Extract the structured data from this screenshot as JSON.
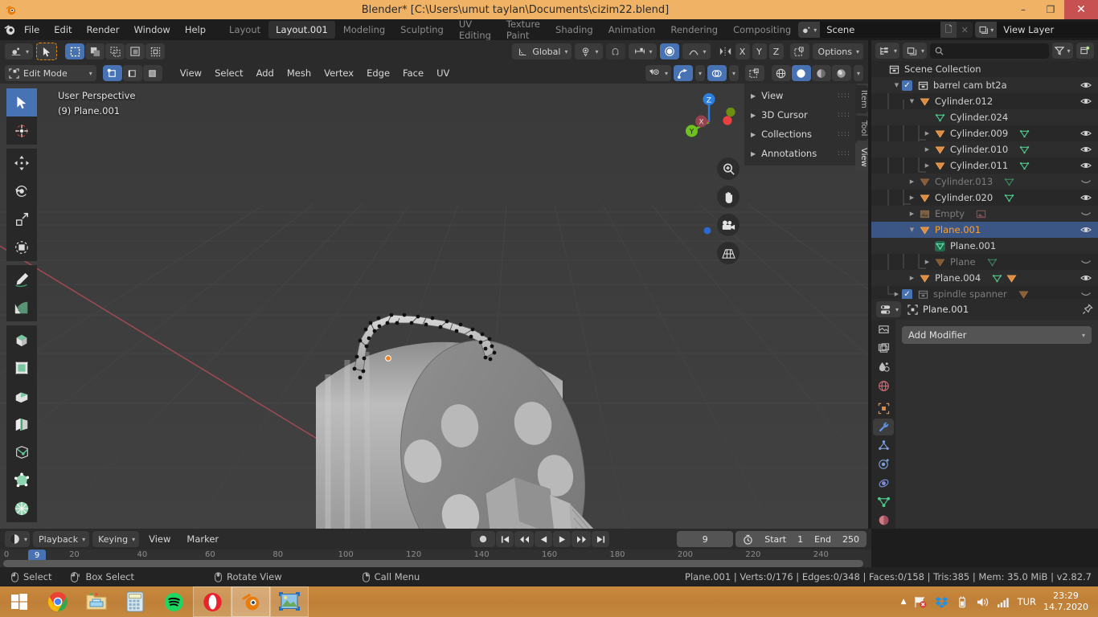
{
  "window": {
    "title": "Blender* [C:\\Users\\umut taylan\\Documents\\cizim22.blend]",
    "minimize": "–",
    "maximize": "❐",
    "close": "✕"
  },
  "topbar": {
    "menus": [
      "File",
      "Edit",
      "Render",
      "Window",
      "Help"
    ],
    "workspaces": [
      {
        "label": "Layout",
        "active": false
      },
      {
        "label": "Layout.001",
        "active": true
      },
      {
        "label": "Modeling",
        "active": false
      },
      {
        "label": "Sculpting",
        "active": false
      },
      {
        "label": "UV Editing",
        "active": false
      },
      {
        "label": "Texture Paint",
        "active": false
      },
      {
        "label": "Shading",
        "active": false
      },
      {
        "label": "Animation",
        "active": false
      },
      {
        "label": "Rendering",
        "active": false
      },
      {
        "label": "Compositing",
        "active": false
      }
    ],
    "scene_name": "Scene",
    "view_layer_name": "View Layer"
  },
  "viewport_header": {
    "transform_orientation": "Global",
    "options_label": "Options",
    "axis_x": "X",
    "axis_y": "Y",
    "axis_z": "Z",
    "mode": "Edit Mode",
    "menus": [
      "View",
      "Select",
      "Add",
      "Mesh",
      "Vertex",
      "Edge",
      "Face",
      "UV"
    ]
  },
  "viewport": {
    "perspective_label": "User Perspective",
    "object_label": "(9) Plane.001",
    "gizmo_axes": {
      "x": "X",
      "y": "Y",
      "z": "Z"
    },
    "npanel": {
      "sections": [
        "View",
        "3D Cursor",
        "Collections",
        "Annotations"
      ],
      "tabs": [
        {
          "label": "Item",
          "active": false
        },
        {
          "label": "Tool",
          "active": false
        },
        {
          "label": "View",
          "active": true
        }
      ]
    },
    "tools": [
      "tweak-tool",
      "cursor-tool",
      "move-tool",
      "rotate-tool",
      "scale-tool",
      "transform-tool",
      "annotate-tool",
      "measure-tool",
      "extrude-region-tool",
      "inset-faces-tool",
      "bevel-tool",
      "loop-cut-tool",
      "knife-tool",
      "poly-build-tool",
      "spin-tool"
    ]
  },
  "outliner": {
    "search_placeholder": "",
    "rows": [
      {
        "indent": 0,
        "name": "Scene Collection",
        "icon": "collection-icon",
        "state": "normal",
        "eye": false,
        "checkbox": false,
        "disclosure": "",
        "datas": []
      },
      {
        "indent": 1,
        "name": "barrel cam bt2a",
        "icon": "collection-icon",
        "state": "normal",
        "eye": true,
        "checkbox": true,
        "disclosure": "down",
        "datas": []
      },
      {
        "indent": 2,
        "name": "Cylinder.012",
        "icon": "mesh-object-icon",
        "state": "normal",
        "eye": true,
        "checkbox": false,
        "disclosure": "down",
        "datas": []
      },
      {
        "indent": 3,
        "name": "Cylinder.024",
        "icon": "mesh-data-icon",
        "state": "normal",
        "eye": false,
        "checkbox": false,
        "disclosure": "",
        "datas": []
      },
      {
        "indent": 3,
        "name": "Cylinder.009",
        "icon": "mesh-object-icon",
        "state": "normal",
        "eye": true,
        "checkbox": false,
        "disclosure": "right",
        "datas": [
          "mesh-data-icon"
        ]
      },
      {
        "indent": 3,
        "name": "Cylinder.010",
        "icon": "mesh-object-icon",
        "state": "normal",
        "eye": true,
        "checkbox": false,
        "disclosure": "right",
        "datas": [
          "mesh-data-icon"
        ]
      },
      {
        "indent": 3,
        "name": "Cylinder.011",
        "icon": "mesh-object-icon",
        "state": "normal",
        "eye": true,
        "checkbox": false,
        "disclosure": "right",
        "datas": [
          "mesh-data-icon"
        ]
      },
      {
        "indent": 2,
        "name": "Cylinder.013",
        "icon": "mesh-object-icon",
        "state": "hidden",
        "eye": "closed",
        "checkbox": false,
        "disclosure": "right",
        "datas": [
          "mesh-data-icon"
        ]
      },
      {
        "indent": 2,
        "name": "Cylinder.020",
        "icon": "mesh-object-icon",
        "state": "normal",
        "eye": true,
        "checkbox": false,
        "disclosure": "right",
        "datas": [
          "mesh-data-icon"
        ]
      },
      {
        "indent": 2,
        "name": "Empty",
        "icon": "empty-image-icon",
        "state": "hidden",
        "eye": "closed",
        "checkbox": false,
        "disclosure": "right",
        "datas": [
          "image-icon"
        ]
      },
      {
        "indent": 2,
        "name": "Plane.001",
        "icon": "mesh-object-icon",
        "state": "selected",
        "eye": true,
        "checkbox": false,
        "disclosure": "down",
        "datas": []
      },
      {
        "indent": 3,
        "name": "Plane.001",
        "icon": "mesh-data-icon-active",
        "state": "normal",
        "eye": false,
        "checkbox": false,
        "disclosure": "",
        "datas": []
      },
      {
        "indent": 3,
        "name": "Plane",
        "icon": "mesh-object-icon",
        "state": "hidden",
        "eye": "closed",
        "checkbox": false,
        "disclosure": "right",
        "datas": [
          "mesh-data-icon"
        ]
      },
      {
        "indent": 2,
        "name": "Plane.004",
        "icon": "mesh-object-icon",
        "state": "normal",
        "eye": true,
        "checkbox": false,
        "disclosure": "right",
        "datas": [
          "mesh-data-icon",
          "modifier-icon"
        ]
      },
      {
        "indent": 1,
        "name": "spindle spanner",
        "icon": "collection-icon",
        "state": "hidden",
        "eye": "closed",
        "checkbox": true,
        "disclosure": "right",
        "datas": [
          "mesh-object-icon"
        ]
      }
    ]
  },
  "properties": {
    "breadcrumb_object": "Plane.001",
    "add_modifier_label": "Add Modifier",
    "tabs": [
      {
        "name": "tool-tab",
        "active": false
      },
      {
        "name": "render-tab",
        "active": false
      },
      {
        "name": "output-tab",
        "active": false
      },
      {
        "name": "view-layer-tab",
        "active": false
      },
      {
        "name": "scene-tab",
        "active": false
      },
      {
        "name": "world-tab",
        "active": false
      },
      {
        "name": "object-tab",
        "active": false
      },
      {
        "name": "modifier-tab",
        "active": true
      },
      {
        "name": "particles-tab",
        "active": false
      },
      {
        "name": "physics-tab",
        "active": false
      },
      {
        "name": "constraints-tab",
        "active": false
      },
      {
        "name": "data-tab",
        "active": false
      },
      {
        "name": "material-tab",
        "active": false
      }
    ]
  },
  "timeline": {
    "menus": [
      "Playback",
      "Keying",
      "View",
      "Marker"
    ],
    "current_frame": "9",
    "start_label": "Start",
    "start_value": "1",
    "end_label": "End",
    "end_value": "250",
    "ticks": [
      "0",
      "20",
      "40",
      "60",
      "80",
      "100",
      "120",
      "140",
      "160",
      "180",
      "200",
      "220",
      "240"
    ],
    "tick_values": [
      0,
      20,
      40,
      60,
      80,
      100,
      120,
      140,
      160,
      180,
      200,
      220,
      240
    ]
  },
  "statusbar": {
    "mouse_hints": [
      {
        "icon": "mouse-left-icon",
        "label": "Select"
      },
      {
        "icon": "mouse-drag-icon",
        "label": "Box Select"
      },
      {
        "icon": "mouse-middle-icon",
        "label": "Rotate View"
      },
      {
        "icon": "mouse-right-icon",
        "label": "Call Menu"
      }
    ],
    "stats": "Plane.001 | Verts:0/176 | Edges:0/348 | Faces:0/158 | Tris:385 | Mem: 35.0 MiB | v2.82.7"
  },
  "taskbar": {
    "apps": [
      {
        "name": "start-button",
        "state": "normal"
      },
      {
        "name": "chrome-icon",
        "state": "normal"
      },
      {
        "name": "file-explorer-icon",
        "state": "normal"
      },
      {
        "name": "calculator-icon",
        "state": "normal"
      },
      {
        "name": "spotify-icon",
        "state": "normal"
      },
      {
        "name": "opera-icon",
        "state": "open"
      },
      {
        "name": "blender-icon",
        "state": "active"
      },
      {
        "name": "photos-icon",
        "state": "open"
      }
    ],
    "language": "TUR",
    "time": "23:29",
    "date": "14.7.2020"
  },
  "colors": {
    "accent_blue": "#4772b3",
    "blender_orange": "#e87d0d",
    "title_bar": "#f0b265",
    "selection_orange": "#ffa028",
    "taskbar": "#c4893f"
  }
}
